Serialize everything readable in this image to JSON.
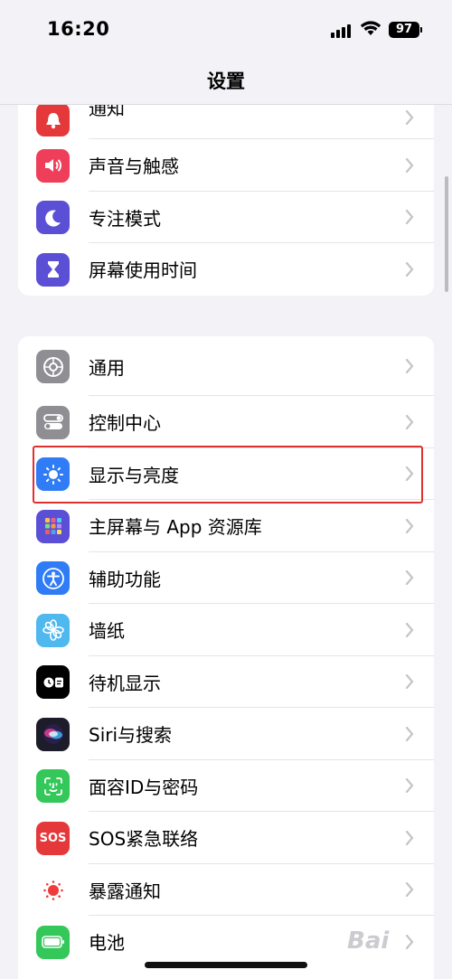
{
  "status_bar": {
    "time": "16:20",
    "battery": "97"
  },
  "nav": {
    "title": "设置"
  },
  "groups": [
    {
      "items": [
        {
          "label": "通知",
          "icon": "bell-icon",
          "color": "#e5383b"
        },
        {
          "label": "声音与触感",
          "icon": "speaker-icon",
          "color": "#ef3e5a"
        },
        {
          "label": "专注模式",
          "icon": "moon-icon",
          "color": "#5b4fd6"
        },
        {
          "label": "屏幕使用时间",
          "icon": "hourglass-icon",
          "color": "#5b4fd6"
        }
      ]
    },
    {
      "items": [
        {
          "label": "通用",
          "icon": "gear-icon",
          "color": "#8e8e93"
        },
        {
          "label": "控制中心",
          "icon": "toggles-icon",
          "color": "#8e8e93"
        },
        {
          "label": "显示与亮度",
          "icon": "sun-icon",
          "color": "#2f7cf6"
        },
        {
          "label": "主屏幕与 App 资源库",
          "icon": "app-grid-icon",
          "color": "#5b4fd6"
        },
        {
          "label": "辅助功能",
          "icon": "accessibility-icon",
          "color": "#2f7cf6"
        },
        {
          "label": "墙纸",
          "icon": "flower-icon",
          "color": "#4fb8ef"
        },
        {
          "label": "待机显示",
          "icon": "standby-icon",
          "color": "#000000"
        },
        {
          "label": "Siri与搜索",
          "icon": "siri-icon",
          "color": "#1c1c2a"
        },
        {
          "label": "面容ID与密码",
          "icon": "face-id-icon",
          "color": "#34c759"
        },
        {
          "label": "SOS紧急联络",
          "icon": "sos-icon",
          "color": "#e5383b"
        },
        {
          "label": "暴露通知",
          "icon": "exposure-icon",
          "color": "#ffffff"
        },
        {
          "label": "电池",
          "icon": "battery-icon",
          "color": "#34c759"
        }
      ]
    }
  ],
  "icons": {
    "sos_text": "SOS"
  },
  "watermark": "Bai"
}
